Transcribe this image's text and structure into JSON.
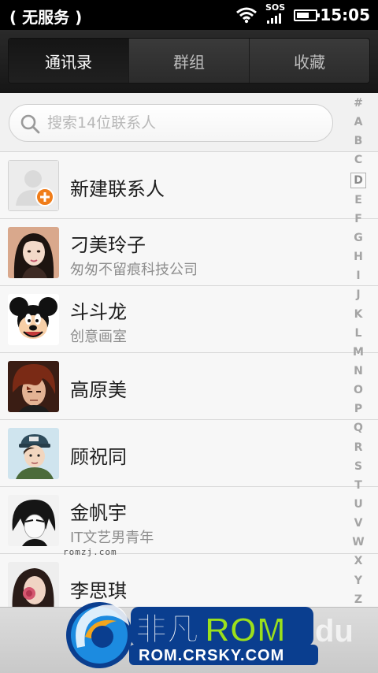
{
  "status_bar": {
    "carrier": "( 无服务 )",
    "sos": "SOS",
    "time": "15:05",
    "battery_level": 0.7
  },
  "tabs": [
    {
      "label": "通讯录",
      "active": true
    },
    {
      "label": "群组",
      "active": false
    },
    {
      "label": "收藏",
      "active": false
    }
  ],
  "search": {
    "placeholder": "搜索14位联系人"
  },
  "new_contact": {
    "label": "新建联系人"
  },
  "contacts": [
    {
      "name": "刁美玲子",
      "subtitle": "匆匆不留痕科技公司",
      "avatar": "girl-portrait"
    },
    {
      "name": "斗斗龙",
      "subtitle": "创意画室",
      "avatar": "mickey-mouse"
    },
    {
      "name": "高原美",
      "subtitle": "",
      "avatar": "boy-red-hair"
    },
    {
      "name": "顾祝同",
      "subtitle": "",
      "avatar": "boy-cap"
    },
    {
      "name": "金帆宇",
      "subtitle": "IT文艺男青年",
      "avatar": "bw-boy"
    },
    {
      "name": "李思琪",
      "subtitle": "",
      "avatar": "girl-rose"
    }
  ],
  "alphabet": [
    "#",
    "A",
    "B",
    "C",
    "D",
    "E",
    "F",
    "G",
    "H",
    "I",
    "J",
    "K",
    "L",
    "M",
    "N",
    "O",
    "P",
    "Q",
    "R",
    "S",
    "T",
    "U",
    "V",
    "W",
    "X",
    "Y",
    "Z"
  ],
  "alphabet_selected": "D",
  "watermark": {
    "small_text": "romzj.com",
    "logo_brand": "非凡",
    "logo_rom": "ROM",
    "logo_url": "ROM.CRSKY.COM",
    "logo_faint": "du"
  },
  "colors": {
    "accent_orange": "#f07d1a",
    "logo_green": "#9be01c",
    "logo_blue": "#0d5bbf"
  }
}
